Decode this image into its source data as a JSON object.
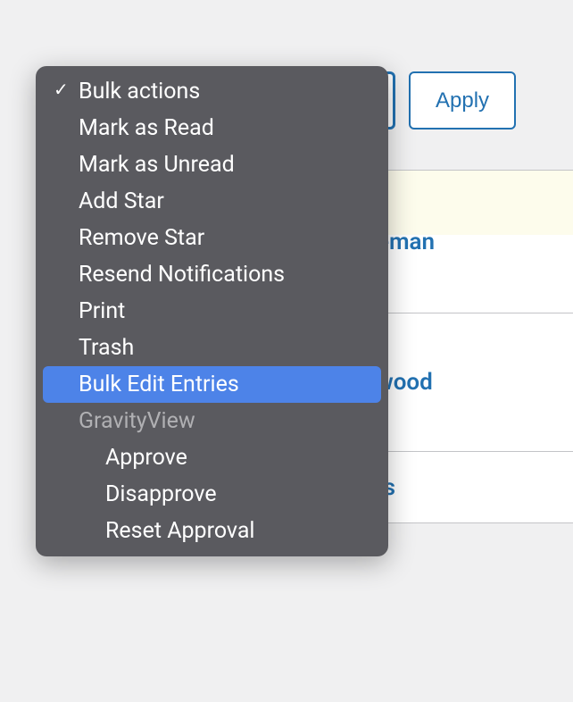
{
  "toolbar": {
    "apply_label": "Apply"
  },
  "dropdown": {
    "items": [
      {
        "label": "Bulk actions",
        "checked": true,
        "type": "item"
      },
      {
        "label": "Mark as Read",
        "type": "item"
      },
      {
        "label": "Mark as Unread",
        "type": "item"
      },
      {
        "label": "Add Star",
        "type": "item"
      },
      {
        "label": "Remove Star",
        "type": "item"
      },
      {
        "label": "Resend Notifications",
        "type": "item"
      },
      {
        "label": "Print",
        "type": "item"
      },
      {
        "label": "Trash",
        "type": "item"
      },
      {
        "label": "Bulk Edit Entries",
        "type": "item",
        "highlighted": true
      },
      {
        "label": "GravityView",
        "type": "group"
      },
      {
        "label": "Approve",
        "type": "sub"
      },
      {
        "label": "Disapprove",
        "type": "sub"
      },
      {
        "label": "Reset Approval",
        "type": "sub"
      }
    ]
  },
  "entries": [
    {
      "name": "Wiseman"
    },
    {
      "name": "eenwood"
    },
    {
      "name": "Shane Sanders"
    }
  ]
}
